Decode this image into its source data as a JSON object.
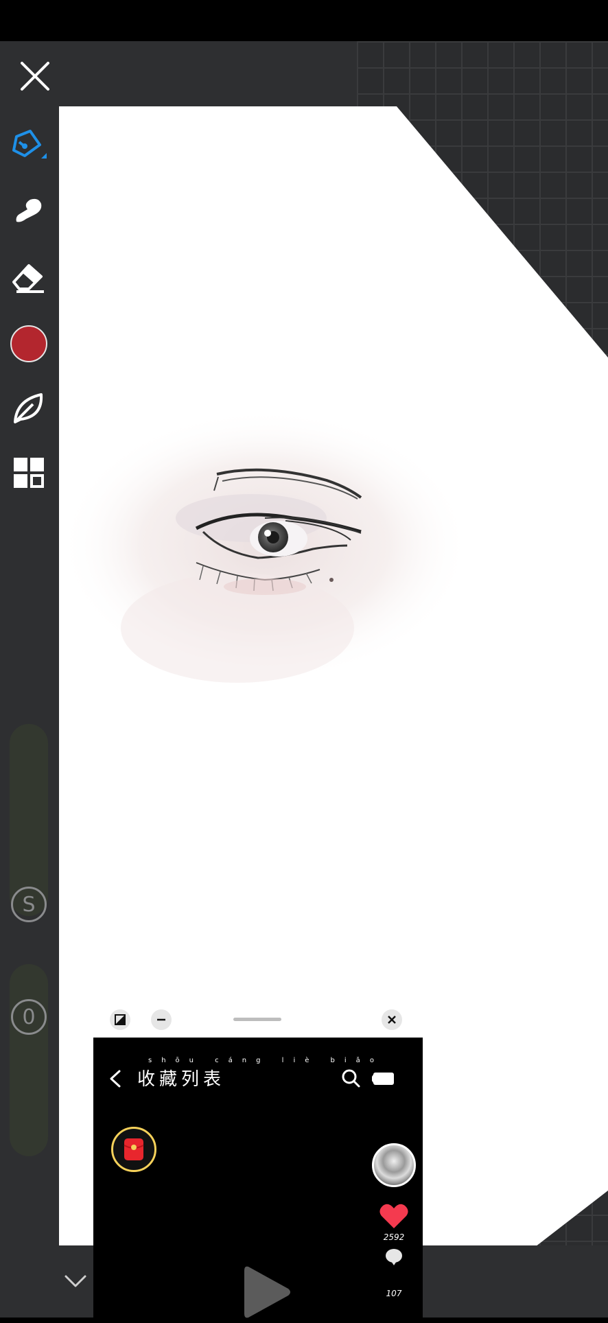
{
  "toolbar": {
    "tools": [
      "pen-tool",
      "smudge-tool",
      "eraser-tool",
      "color-swatch",
      "leaf-brush-tool",
      "layers-tool"
    ],
    "active_color": "#b3262e",
    "accent": "#1e90e8",
    "size_label": "S",
    "opacity_label": "0"
  },
  "pip": {
    "title": "收藏列表",
    "pinyin": "shōu cáng liè biǎo",
    "like_count": "2592",
    "comment_count": "107"
  }
}
